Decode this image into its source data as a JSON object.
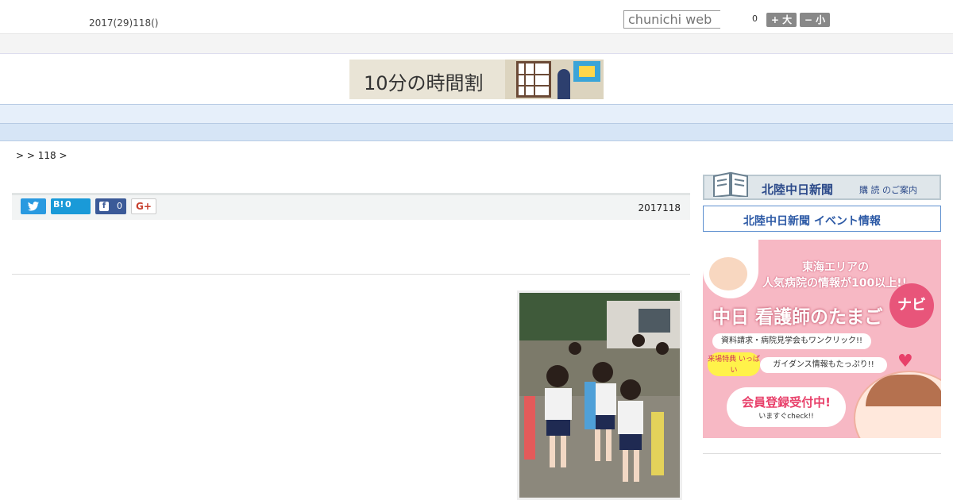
{
  "header": {
    "date_text": "2017(29)118()",
    "search_placeholder": "chunichi web",
    "font_size_count": "0",
    "font_large_label": "+ 大",
    "font_small_label": "− 小"
  },
  "logo_banner": {
    "text": "10分の時間割"
  },
  "nav": {
    "items": [
      "　　",
      "　　",
      "　　",
      "　　",
      "　　",
      "　　",
      "　　",
      "　　",
      "　　"
    ]
  },
  "breadcrumb": {
    "text": ">  > 118 >"
  },
  "share": {
    "hatena_label": "B!",
    "hatena_count": "0",
    "facebook_label": "f",
    "facebook_count": "0",
    "google_label": "G+"
  },
  "article": {
    "date": "2017118"
  },
  "sidebar": {
    "ad1_title": "北陸中日新聞",
    "ad1_sub": "購 読 のご案内",
    "ad2_title": "北陸中日新聞 イベント情報",
    "ad3": {
      "line1": "東海エリアの",
      "line2": "人気病院の情報が100以上!!",
      "headline": "中日 看護師のたまご",
      "nabi": "ナビ",
      "pill1": "資料請求・病院見学会もワンクリック!!",
      "badge": "来場特典 いっぱい",
      "pill2": "ガイダンス情報もたっぷり!!",
      "cta": "会員登録受付中!",
      "cta_sub": "いますぐcheck!!"
    }
  },
  "colors": {
    "nav_bg": "#e6effa",
    "twitter": "#2a9ae0",
    "hatena": "#1a9ad8",
    "facebook": "#3b5a98",
    "ad_pink": "#f7b8c4"
  }
}
